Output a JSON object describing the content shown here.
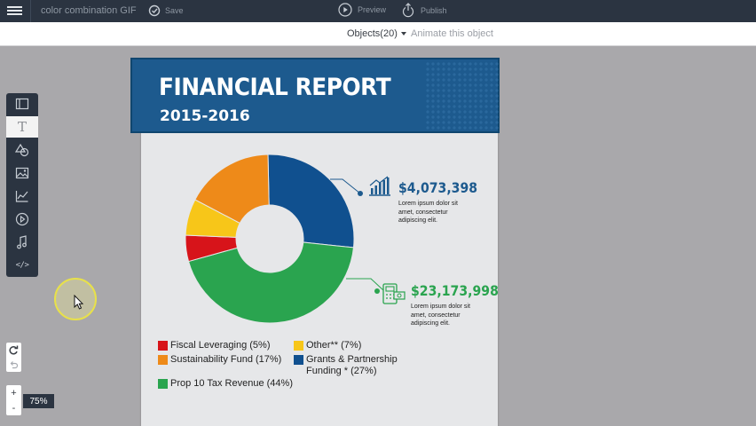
{
  "topbar": {
    "doc_title": "color combination GIF",
    "save_label": "Save",
    "preview_label": "Preview",
    "publish_label": "Publish"
  },
  "subbar": {
    "objects_label": "Objects(20)",
    "animate_label": "Animate this object"
  },
  "tools": [
    {
      "name": "background-icon"
    },
    {
      "name": "text-icon",
      "glyph": "T",
      "active": true
    },
    {
      "name": "shapes-icon"
    },
    {
      "name": "image-icon"
    },
    {
      "name": "chart-icon"
    },
    {
      "name": "video-icon"
    },
    {
      "name": "music-icon"
    },
    {
      "name": "embed-code-icon",
      "glyph": "</>"
    }
  ],
  "zoom": {
    "plus": "+",
    "minus": "-",
    "level": "75%"
  },
  "report": {
    "title": "FINANCIAL REPORT",
    "years": "2015-2016",
    "stat1": {
      "value": "$4,073,398",
      "desc": "Lorem ipsum dolor sit amet, consectetur adipiscing elit.",
      "color": "#1d5a8e"
    },
    "stat2": {
      "value": "$23,173,998",
      "desc": "Lorem ipsum dolor sit amet, consectetur adipiscing elit.",
      "color": "#2aa44f"
    },
    "legend": [
      {
        "label": "Fiscal Leveraging (5%)",
        "color": "#d7141a"
      },
      {
        "label": "Other** (7%)",
        "color": "#f7c619"
      },
      {
        "label": "Sustainability Fund (17%)",
        "color": "#ee8a19"
      },
      {
        "label": "Grants & Partnership Funding * (27%)",
        "color": "#10508f"
      },
      {
        "label": "Prop 10 Tax Revenue (44%)",
        "color": "#2aa44f"
      }
    ]
  },
  "colors": {
    "topbar": "#2b3441",
    "canvas": "#a9a8ab",
    "banner": "#1d5a8e"
  },
  "chart_data": {
    "type": "pie",
    "categories": [
      "Grants & Partnership Funding *",
      "Prop 10 Tax Revenue",
      "Fiscal Leveraging",
      "Other**",
      "Sustainability Fund"
    ],
    "values": [
      27,
      44,
      5,
      7,
      17
    ],
    "colors": [
      "#10508f",
      "#2aa44f",
      "#d7141a",
      "#f7c619",
      "#ee8a19"
    ],
    "donut": true
  }
}
